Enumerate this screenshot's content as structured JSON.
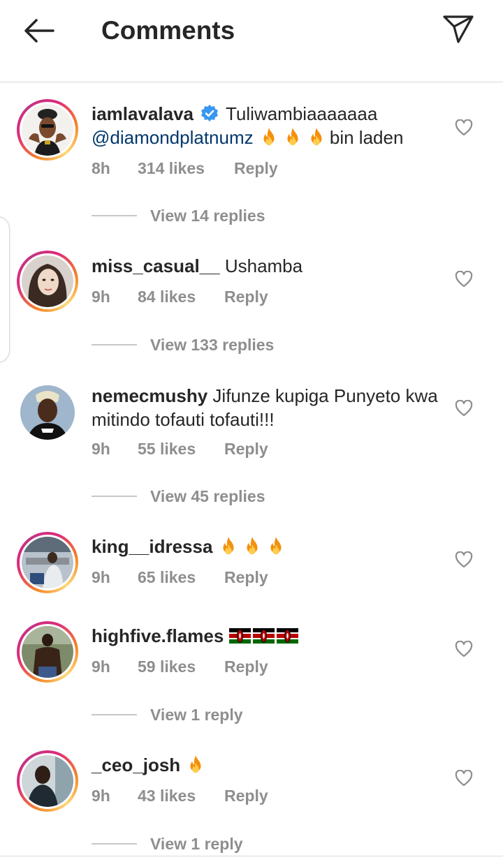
{
  "header": {
    "title": "Comments",
    "back_icon": "arrow-left-icon",
    "share_icon": "paper-plane-icon"
  },
  "comments": [
    {
      "username": "iamlavalava",
      "verified": true,
      "text": "Tuliwambiaaaaaaa",
      "mention": "@diamondplatnumz",
      "emojis": [
        "fire",
        "fire",
        "fire"
      ],
      "text_after": "bin laden",
      "time": "8h",
      "likes": "314 likes",
      "reply": "Reply",
      "view_replies": "View 14 replies",
      "story_ring": true
    },
    {
      "username": "miss_casual__",
      "text": "Ushamba",
      "time": "9h",
      "likes": "84 likes",
      "reply": "Reply",
      "view_replies": "View 133 replies",
      "story_ring": true
    },
    {
      "username": "nemecmushy",
      "text": "Jifunze kupiga Punyeto kwa mitindo tofauti tofauti!!!",
      "time": "9h",
      "likes": "55 likes",
      "reply": "Reply",
      "view_replies": "View 45 replies",
      "story_ring": false
    },
    {
      "username": "king__idressa",
      "emojis": [
        "fire",
        "fire",
        "fire"
      ],
      "time": "9h",
      "likes": "65 likes",
      "reply": "Reply",
      "story_ring": true
    },
    {
      "username": "highfive.flames",
      "emojis": [
        "kenya-flag",
        "kenya-flag",
        "kenya-flag"
      ],
      "time": "9h",
      "likes": "59 likes",
      "reply": "Reply",
      "view_replies": "View 1 reply",
      "story_ring": true
    },
    {
      "username": "_ceo_josh",
      "emojis": [
        "fire"
      ],
      "time": "9h",
      "likes": "43 likes",
      "reply": "Reply",
      "view_replies": "View 1 reply",
      "story_ring": true
    }
  ],
  "colors": {
    "text": "#262626",
    "meta": "#8e8e8e",
    "mention": "#00376b",
    "verified": "#3897f0",
    "divider": "#dbdbdb"
  }
}
